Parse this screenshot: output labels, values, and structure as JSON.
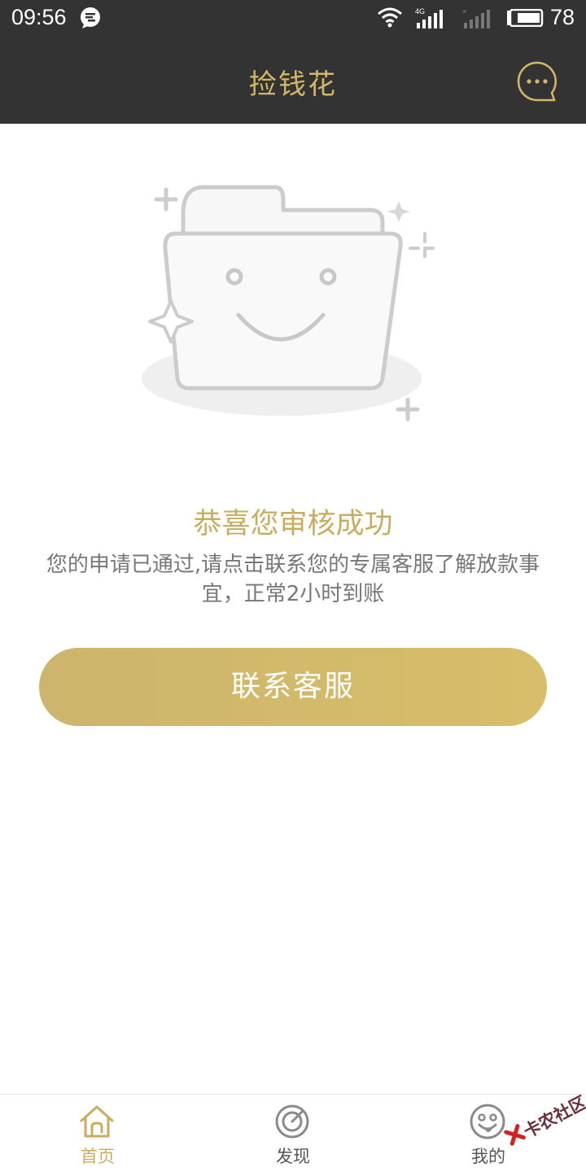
{
  "status_bar": {
    "time": "09:56",
    "network": "4G",
    "battery": "78"
  },
  "header": {
    "title": "捡钱花"
  },
  "main": {
    "success_title": "恭喜您审核成功",
    "success_description": "您的申请已通过,请点击联系您的专属客服了解放款事宜，正常2小时到账",
    "contact_button_label": "联系客服"
  },
  "tab_bar": {
    "items": [
      {
        "label": "首页",
        "icon": "home-icon",
        "active": true
      },
      {
        "label": "发现",
        "icon": "discover-icon",
        "active": false
      },
      {
        "label": "我的",
        "icon": "smiley-icon",
        "active": false
      }
    ]
  },
  "watermark": {
    "text": "卡农社区"
  },
  "colors": {
    "accent": "#d4b86a",
    "header_bg": "#333333",
    "button_bg": "#d4bb6b"
  }
}
